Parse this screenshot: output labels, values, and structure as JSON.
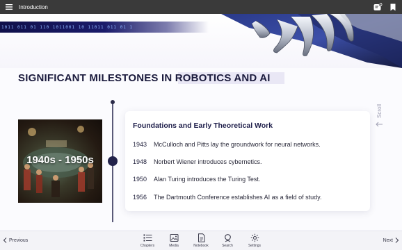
{
  "topbar": {
    "title": "Introduction"
  },
  "hero": {
    "binary": "1011 011 01 110 1011001 10 11011 011 01 1"
  },
  "page_title": "SIGNIFICANT MILESTONES IN ROBOTICS AND AI",
  "era": {
    "label": "1940s - 1950s"
  },
  "card": {
    "title": "Foundations and Early Theoretical Work",
    "milestones": [
      {
        "year": "1943",
        "text": "McCulloch and Pitts lay the groundwork for neural networks."
      },
      {
        "year": "1948",
        "text": "Norbert Wiener introduces cybernetics."
      },
      {
        "year": "1950",
        "text": "Alan Turing introduces the Turing Test."
      },
      {
        "year": "1956",
        "text": "The Dartmouth Conference establishes AI as a field of study."
      }
    ]
  },
  "scroll_hint": "Scroll",
  "bottombar": {
    "prev": "Previous",
    "next": "Next",
    "tools": [
      {
        "label": "Chapters",
        "icon": "list-icon"
      },
      {
        "label": "Media",
        "icon": "image-icon"
      },
      {
        "label": "Notebook",
        "icon": "notebook-icon"
      },
      {
        "label": "Search",
        "icon": "search-icon"
      },
      {
        "label": "Settings",
        "icon": "gear-icon"
      }
    ]
  }
}
